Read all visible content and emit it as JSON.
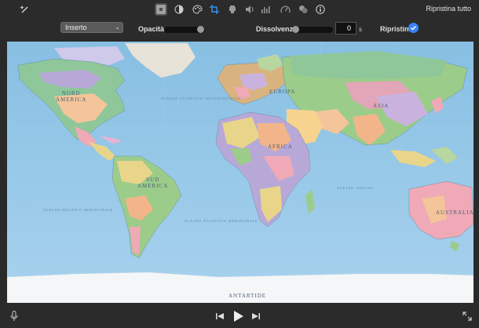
{
  "toolbar": {
    "reset_all_label": "Ripristina tutto",
    "icons": [
      "magic-wand-icon",
      "crop-overlay-icon",
      "color-balance-icon",
      "palette-icon",
      "crop-icon",
      "stabilization-icon",
      "volume-icon",
      "equalizer-icon",
      "speed-icon",
      "noise-reduction-icon",
      "info-icon"
    ]
  },
  "controls": {
    "mode_value": "Inserto",
    "opacity_label": "Opacità:",
    "fade_label": "Dissolvenza:",
    "fade_value": "0",
    "fade_unit": "s",
    "reset_label": "Ripristina"
  },
  "map": {
    "labels": {
      "north_america": "NORD\nAMERICA",
      "south_america": "SUD\nAMERICA",
      "europe": "EUROPA",
      "africa": "AFRICA",
      "asia": "ASIA",
      "australia": "AUSTRALIA",
      "antarctica": "ANTARTIDE"
    },
    "oceans": {
      "north_atlantic": "OCEANO ATLANTICO SETTENTRIONALE",
      "south_pacific": "OCEANO PACIFICO MERIDIONALE",
      "south_atlantic": "OCEANO ATLANTICO MERIDIONALE",
      "indian": "OCEANO INDIANO"
    }
  },
  "playback": {
    "icons": [
      "microphone-icon",
      "skip-back-icon",
      "play-icon",
      "skip-forward-icon",
      "fullscreen-icon"
    ]
  }
}
